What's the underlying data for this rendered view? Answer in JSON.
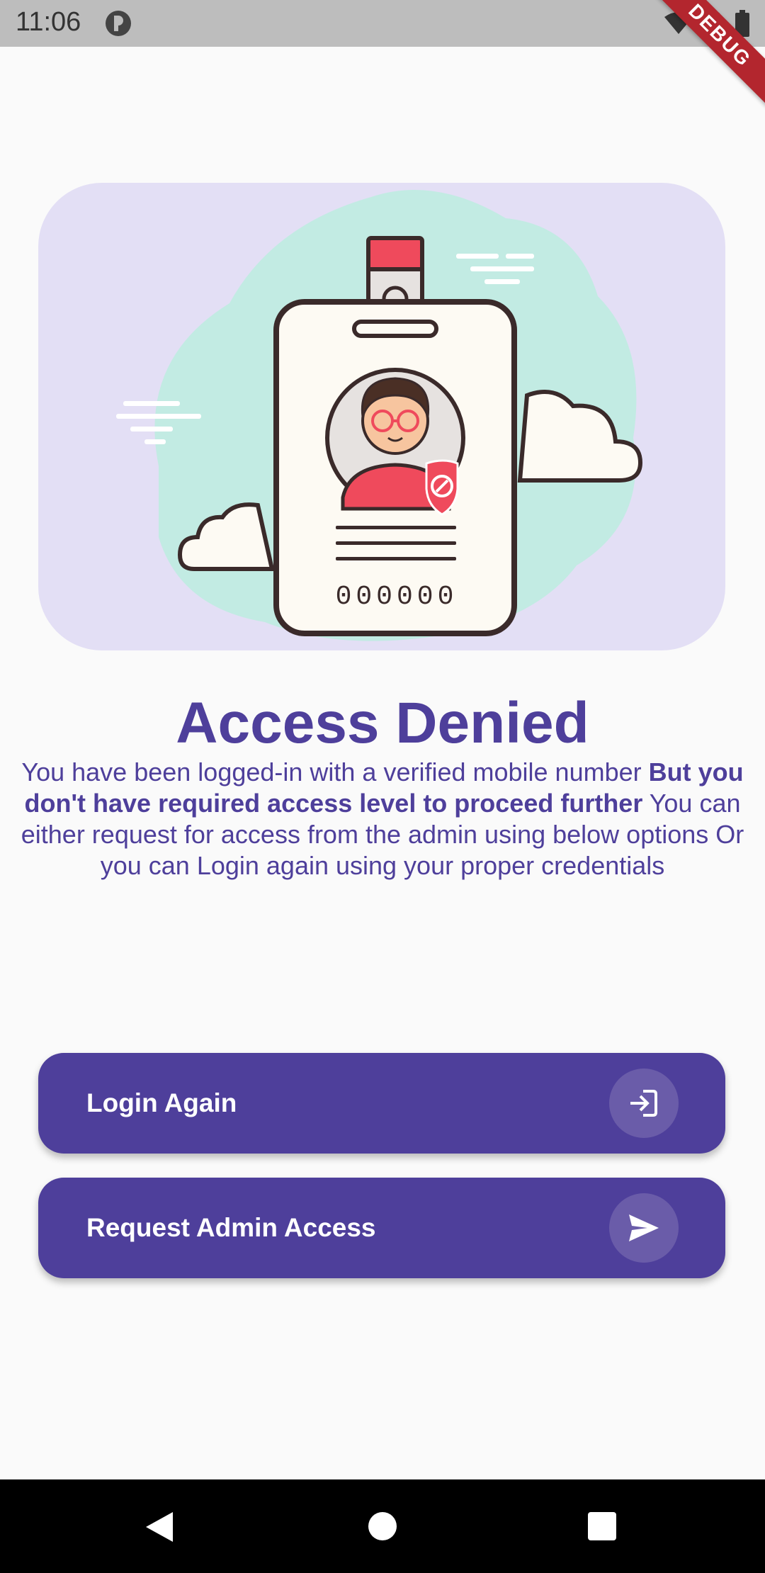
{
  "status_bar": {
    "time": "11:06",
    "app_icon": "app-notification-icon",
    "wifi_icon": "wifi-icon",
    "signal_icon": "cell-signal-icon",
    "battery_icon": "battery-icon"
  },
  "debug_banner": "DEBUG",
  "illustration": {
    "badge_number": "000000",
    "icon": "id-card-access-denied-icon"
  },
  "title": "Access Denied",
  "message": {
    "part1": "You have been logged-in with a verified mobile number ",
    "bold": "But you don't have required access level to proceed further",
    "part2": " You can either request for access from the admin using below options Or you can Login again using your proper credentials"
  },
  "buttons": {
    "login_again": {
      "label": "Login Again",
      "icon": "login-icon"
    },
    "request_admin": {
      "label": "Request Admin Access",
      "icon": "send-icon"
    }
  },
  "nav_bar": {
    "back_icon": "back-icon",
    "home_icon": "home-icon",
    "recents_icon": "recents-icon"
  },
  "colors": {
    "primary": "#4e3f9b",
    "card_background": "#e3dff5",
    "debug_ribbon": "#b3262e"
  }
}
